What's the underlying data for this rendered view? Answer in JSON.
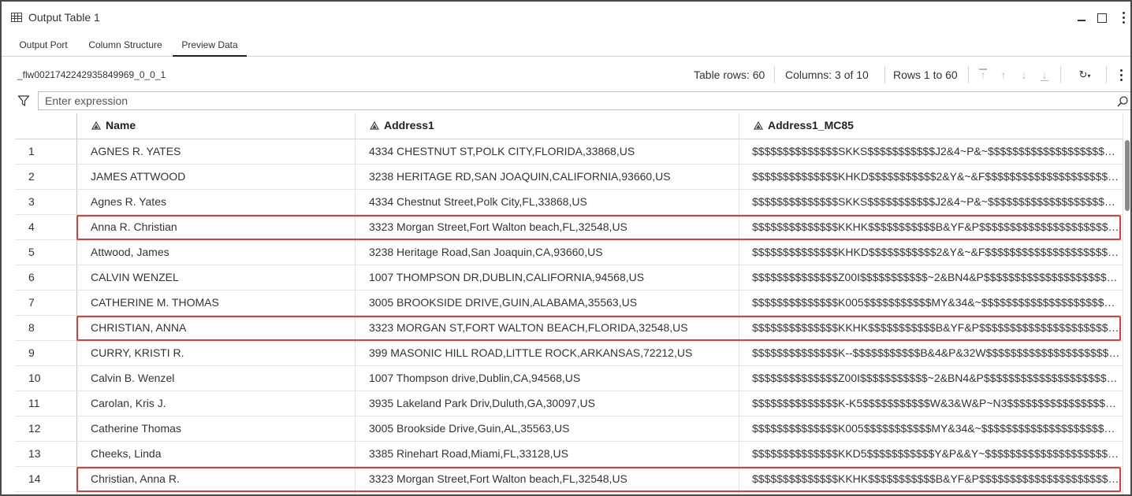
{
  "window": {
    "title": "Output Table 1"
  },
  "tabs": [
    {
      "label": "Output Port"
    },
    {
      "label": "Column Structure"
    },
    {
      "label": "Preview Data",
      "active": true
    }
  ],
  "toolbar": {
    "table_name": "_flw0021742242935849969_0_0_1",
    "table_rows": "Table rows: 60",
    "columns": "Columns: 3 of 10",
    "rows_range": "Rows 1 to 60"
  },
  "filter": {
    "placeholder": "Enter expression"
  },
  "columns": [
    {
      "label": "Name"
    },
    {
      "label": "Address1"
    },
    {
      "label": "Address1_MC85"
    }
  ],
  "rows": [
    {
      "n": "1",
      "name": "AGNES R. YATES",
      "addr": "4334 CHESTNUT ST,POLK CITY,FLORIDA,33868,US",
      "mc": "$$$$$$$$$$$$$$SKKS$$$$$$$$$$$J2&4~P&~$$$$$$$$$$$$$$$$$$$$$$$$$$$$"
    },
    {
      "n": "2",
      "name": "JAMES ATTWOOD",
      "addr": "3238 HERITAGE RD,SAN JOAQUIN,CALIFORNIA,93660,US",
      "mc": "$$$$$$$$$$$$$$KHKD$$$$$$$$$$$2&Y&~&F$$$$$$$$$$$$$$$$$$$$$$$$$$$$"
    },
    {
      "n": "3",
      "name": "Agnes R. Yates",
      "addr": "4334 Chestnut Street,Polk City,FL,33868,US",
      "mc": "$$$$$$$$$$$$$$SKKS$$$$$$$$$$$J2&4~P&~$$$$$$$$$$$$$$$$$$$$$$$$$$$$"
    },
    {
      "n": "4",
      "name": "Anna R. Christian",
      "addr": "3323 Morgan Street,Fort Walton beach,FL,32548,US",
      "mc": "$$$$$$$$$$$$$$KKHK$$$$$$$$$$$B&YF&P$$$$$$$$$$$$$$$$$$$$$$$$$$$$",
      "highlight": true
    },
    {
      "n": "5",
      "name": "Attwood, James",
      "addr": "3238 Heritage Road,San Joaquin,CA,93660,US",
      "mc": "$$$$$$$$$$$$$$KHKD$$$$$$$$$$$2&Y&~&F$$$$$$$$$$$$$$$$$$$$$$$$$$$$"
    },
    {
      "n": "6",
      "name": "CALVIN WENZEL",
      "addr": "1007 THOMPSON DR,DUBLIN,CALIFORNIA,94568,US",
      "mc": "$$$$$$$$$$$$$$Z00I$$$$$$$$$$$~2&BN4&P$$$$$$$$$$$$$$$$$$$$$$$$$$$"
    },
    {
      "n": "7",
      "name": "CATHERINE M. THOMAS",
      "addr": "3005 BROOKSIDE DRIVE,GUIN,ALABAMA,35563,US",
      "mc": "$$$$$$$$$$$$$$K005$$$$$$$$$$$MY&34&~$$$$$$$$$$$$$$$$$$$$$$$$$$$$"
    },
    {
      "n": "8",
      "name": "CHRISTIAN, ANNA",
      "addr": "3323 MORGAN ST,FORT WALTON BEACH,FLORIDA,32548,US",
      "mc": "$$$$$$$$$$$$$$KKHK$$$$$$$$$$$B&YF&P$$$$$$$$$$$$$$$$$$$$$$$$$$$$",
      "highlight": true
    },
    {
      "n": "9",
      "name": "CURRY, KRISTI R.",
      "addr": "399 MASONIC HILL ROAD,LITTLE ROCK,ARKANSAS,72212,US",
      "mc": "$$$$$$$$$$$$$$K--$$$$$$$$$$$B&4&P&32W$$$$$$$$$$$$$$$$$$$$$$$$$$$"
    },
    {
      "n": "10",
      "name": "Calvin B. Wenzel",
      "addr": "1007 Thompson drive,Dublin,CA,94568,US",
      "mc": "$$$$$$$$$$$$$$Z00I$$$$$$$$$$$~2&BN4&P$$$$$$$$$$$$$$$$$$$$$$$$$$$"
    },
    {
      "n": "11",
      "name": "Carolan, Kris J.",
      "addr": "3935 Lakeland Park Driv,Duluth,GA,30097,US",
      "mc": "$$$$$$$$$$$$$$K-K5$$$$$$$$$$$W&3&W&P~N3$$$$$$$$$$$$$$$$$$$$$$$$$"
    },
    {
      "n": "12",
      "name": "Catherine Thomas",
      "addr": "3005 Brookside Drive,Guin,AL,35563,US",
      "mc": "$$$$$$$$$$$$$$K005$$$$$$$$$$$MY&34&~$$$$$$$$$$$$$$$$$$$$$$$$$$$$"
    },
    {
      "n": "13",
      "name": "Cheeks, Linda",
      "addr": "3385 Rinehart Road,Miami,FL,33128,US",
      "mc": "$$$$$$$$$$$$$$KKD5$$$$$$$$$$$Y&P&&Y~$$$$$$$$$$$$$$$$$$$$$$$$$$$$"
    },
    {
      "n": "14",
      "name": "Christian, Anna R.",
      "addr": "3323 Morgan Street,Fort Walton beach,FL,32548,US",
      "mc": "$$$$$$$$$$$$$$KKHK$$$$$$$$$$$B&YF&P$$$$$$$$$$$$$$$$$$$$$$$$$$$$",
      "highlight": true
    }
  ],
  "icons": {
    "title": "table-icon",
    "minimize": "minimize-icon",
    "maximize": "maximize-icon",
    "more": "more-vertical-icon",
    "filter": "filter-icon",
    "search": "search-icon",
    "column_type": "text-type-icon",
    "refresh": "refresh-icon"
  },
  "colors": {
    "highlight": "#e03c3c",
    "border": "#4a4a4a",
    "grid_line": "#e2e2e2"
  }
}
